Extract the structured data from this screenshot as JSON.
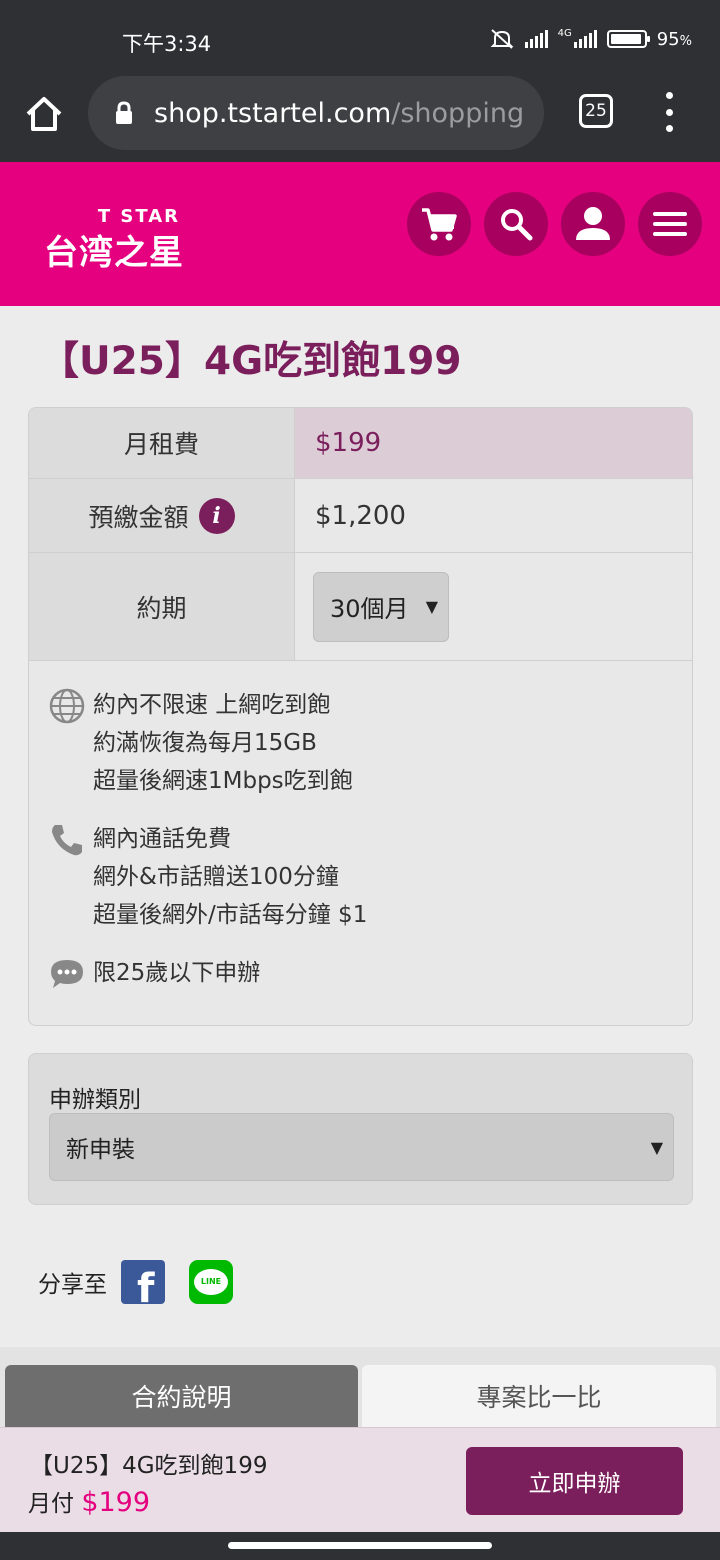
{
  "status_bar": {
    "time": "下午3:34",
    "network": "4G",
    "battery": "95",
    "battery_unit": "%",
    "battery_level": 0.95
  },
  "browser": {
    "url_host": "shop.tstartel.com",
    "url_path": "/shopping/i",
    "tab_count": "25"
  },
  "header": {
    "logo_en": "T STAR",
    "logo_zh": "台湾之星",
    "icons": [
      "cart-icon",
      "search-icon",
      "user-icon",
      "menu-icon"
    ],
    "brand_color": "#e4007f",
    "accent_color": "#7b1e5c"
  },
  "plan": {
    "title": "【U25】4G吃到飽199",
    "rows": [
      {
        "label": "月租費",
        "value": "$199"
      },
      {
        "label": "預繳金額",
        "value": "$1,200"
      },
      {
        "label": "約期",
        "value": "30個月"
      }
    ],
    "features": [
      {
        "icon": "globe-icon",
        "lines": [
          "約內不限速 上網吃到飽",
          "約滿恢復為每月15GB",
          "超量後網速1Mbps吃到飽"
        ]
      },
      {
        "icon": "phone-icon",
        "lines": [
          "網內通話免費",
          "網外&市話贈送100分鐘",
          "超量後網外/市話每分鐘 $1"
        ]
      },
      {
        "icon": "chat-icon",
        "lines": [
          "限25歲以下申辦"
        ]
      }
    ]
  },
  "apply_type": {
    "label": "申辦類別",
    "selected": "新申裝"
  },
  "share": {
    "label": "分享至",
    "facebook_glyph": "f",
    "line_glyph": "LINE"
  },
  "tabs": [
    {
      "label": "合約說明",
      "active": true
    },
    {
      "label": "專案比一比",
      "active": false
    }
  ],
  "bottom_bar": {
    "name": "【U25】4G吃到飽199",
    "monthly_label": "月付",
    "monthly_price": "$199",
    "apply_button": "立即申辦"
  }
}
